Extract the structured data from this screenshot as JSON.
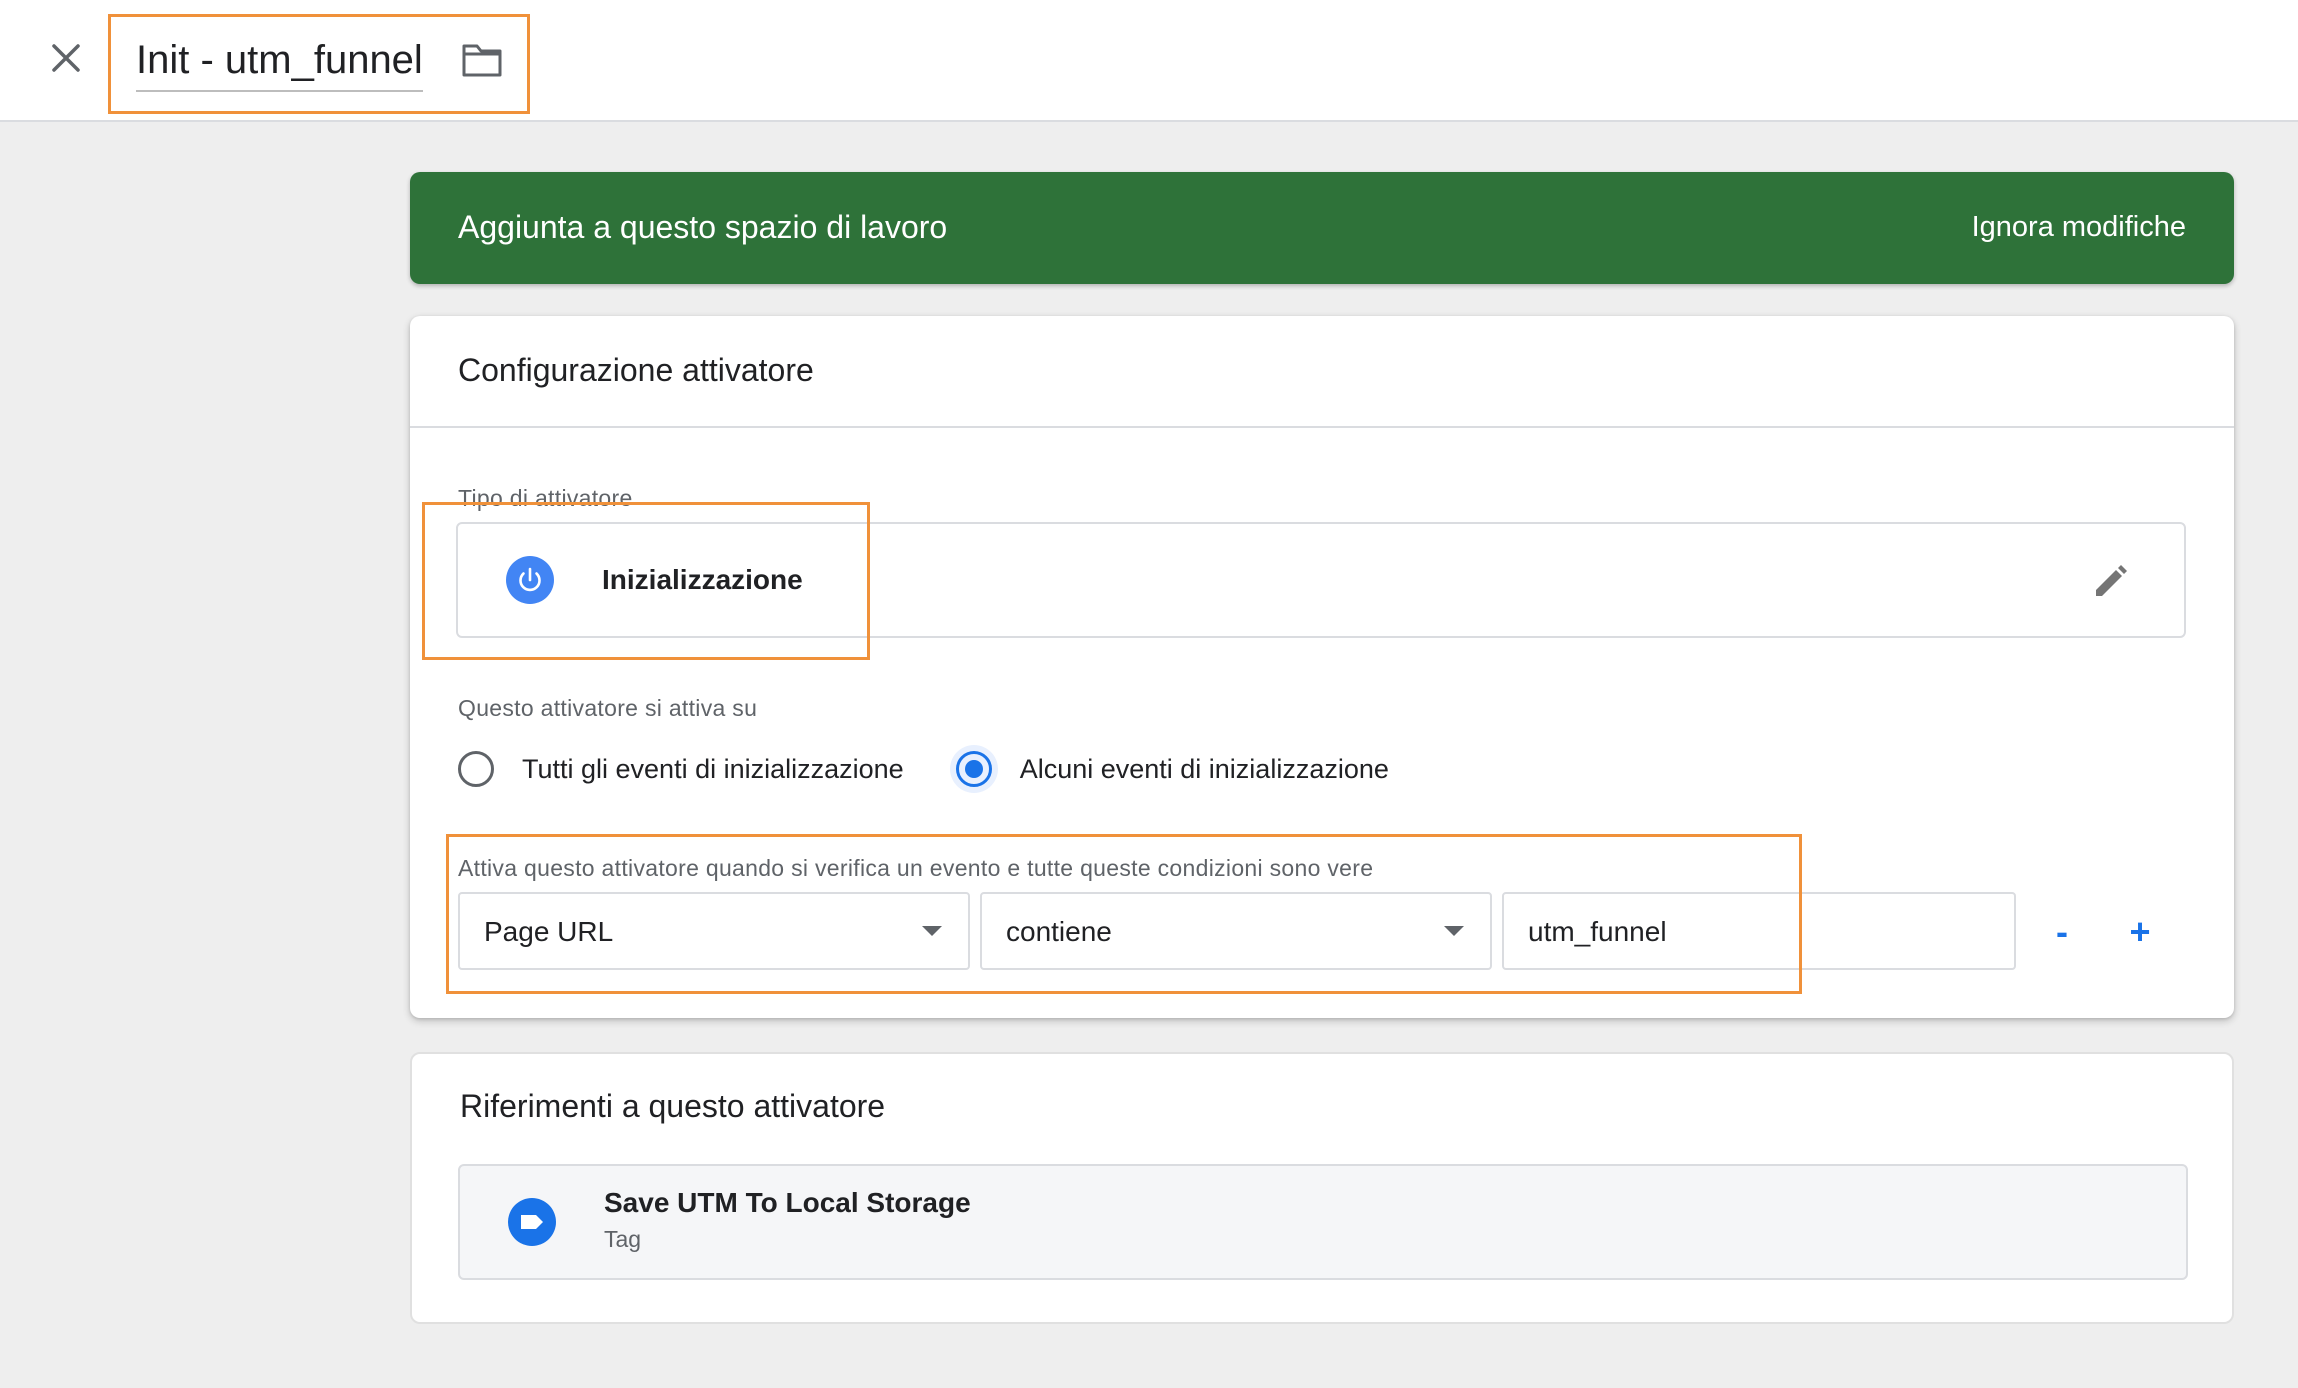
{
  "header": {
    "trigger_name": "Init - utm_funnel",
    "close_icon": "close-icon",
    "folder_icon": "folder-icon"
  },
  "banner": {
    "title": "Aggiunta a questo spazio di lavoro",
    "action": "Ignora modifiche",
    "color": "#2e7239"
  },
  "config": {
    "title": "Configurazione attivatore",
    "type_label": "Tipo di attivatore",
    "type_name": "Inizializzazione",
    "type_icon": "power-icon",
    "edit_icon": "pencil-icon",
    "fires_on_label": "Questo attivatore si attiva su",
    "radio_options": [
      {
        "label": "Tutti gli eventi di inizializzazione",
        "checked": false
      },
      {
        "label": "Alcuni eventi di inizializzazione",
        "checked": true
      }
    ],
    "condition_label": "Attiva questo attivatore quando si verifica un evento e tutte queste condizioni sono vere",
    "condition": {
      "variable": "Page URL",
      "operator": "contiene",
      "value": "utm_funnel"
    },
    "remove_label": "-",
    "add_label": "+"
  },
  "references": {
    "title": "Riferimenti a questo attivatore",
    "items": [
      {
        "name": "Save UTM To Local Storage",
        "type": "Tag",
        "icon": "tag-icon"
      }
    ]
  },
  "colors": {
    "accent_blue": "#1a73e8",
    "highlight_orange": "#f0913a"
  }
}
